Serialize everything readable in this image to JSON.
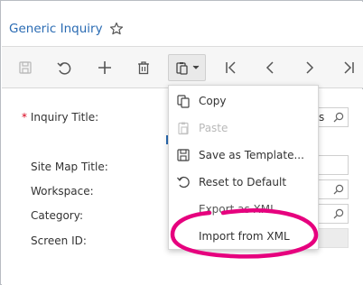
{
  "header": {
    "title": "Generic Inquiry",
    "favorite_icon": "star-outline-icon"
  },
  "toolbar": {
    "buttons": [
      {
        "name": "save-button",
        "icon": "save-icon",
        "enabled": false
      },
      {
        "name": "undo-button",
        "icon": "undo-icon",
        "enabled": true
      },
      {
        "name": "add-button",
        "icon": "plus-icon",
        "enabled": true
      },
      {
        "name": "delete-button",
        "icon": "trash-icon",
        "enabled": true
      },
      {
        "name": "clipboard-button",
        "icon": "clipboard-icon",
        "enabled": true,
        "has_dropdown": true
      },
      {
        "name": "first-button",
        "icon": "first-record-icon",
        "enabled": true
      },
      {
        "name": "previous-button",
        "icon": "chevron-left-icon",
        "enabled": true
      },
      {
        "name": "next-button",
        "icon": "chevron-right-icon",
        "enabled": true
      },
      {
        "name": "last-button",
        "icon": "last-record-icon",
        "enabled": true
      }
    ]
  },
  "form": {
    "inquiry_title": {
      "required_mark": "*",
      "label": "Inquiry Title:",
      "value_fragment": "s"
    },
    "site_map_title": {
      "label": "Site Map Title:"
    },
    "workspace": {
      "label": "Workspace:"
    },
    "category": {
      "label": "Category:"
    },
    "screen_id": {
      "label": "Screen ID:"
    }
  },
  "menu": {
    "items": [
      {
        "label": "Copy",
        "icon": "copy-icon",
        "enabled": true
      },
      {
        "label": "Paste",
        "icon": "paste-icon",
        "enabled": false
      },
      {
        "label": "Save as Template...",
        "icon": "save-template-icon",
        "enabled": true
      },
      {
        "label": "Reset to Default",
        "icon": "reset-icon",
        "enabled": true
      },
      {
        "label": "Export as XML",
        "icon": "",
        "enabled": true
      },
      {
        "label": "Import from XML",
        "icon": "",
        "enabled": true
      }
    ]
  },
  "colors": {
    "title": "#2a6bb3",
    "required": "#d9001b",
    "highlight": "#e6007e",
    "toolbar_bg": "#f6f6f6",
    "disabled_text": "#b9b9b9"
  }
}
